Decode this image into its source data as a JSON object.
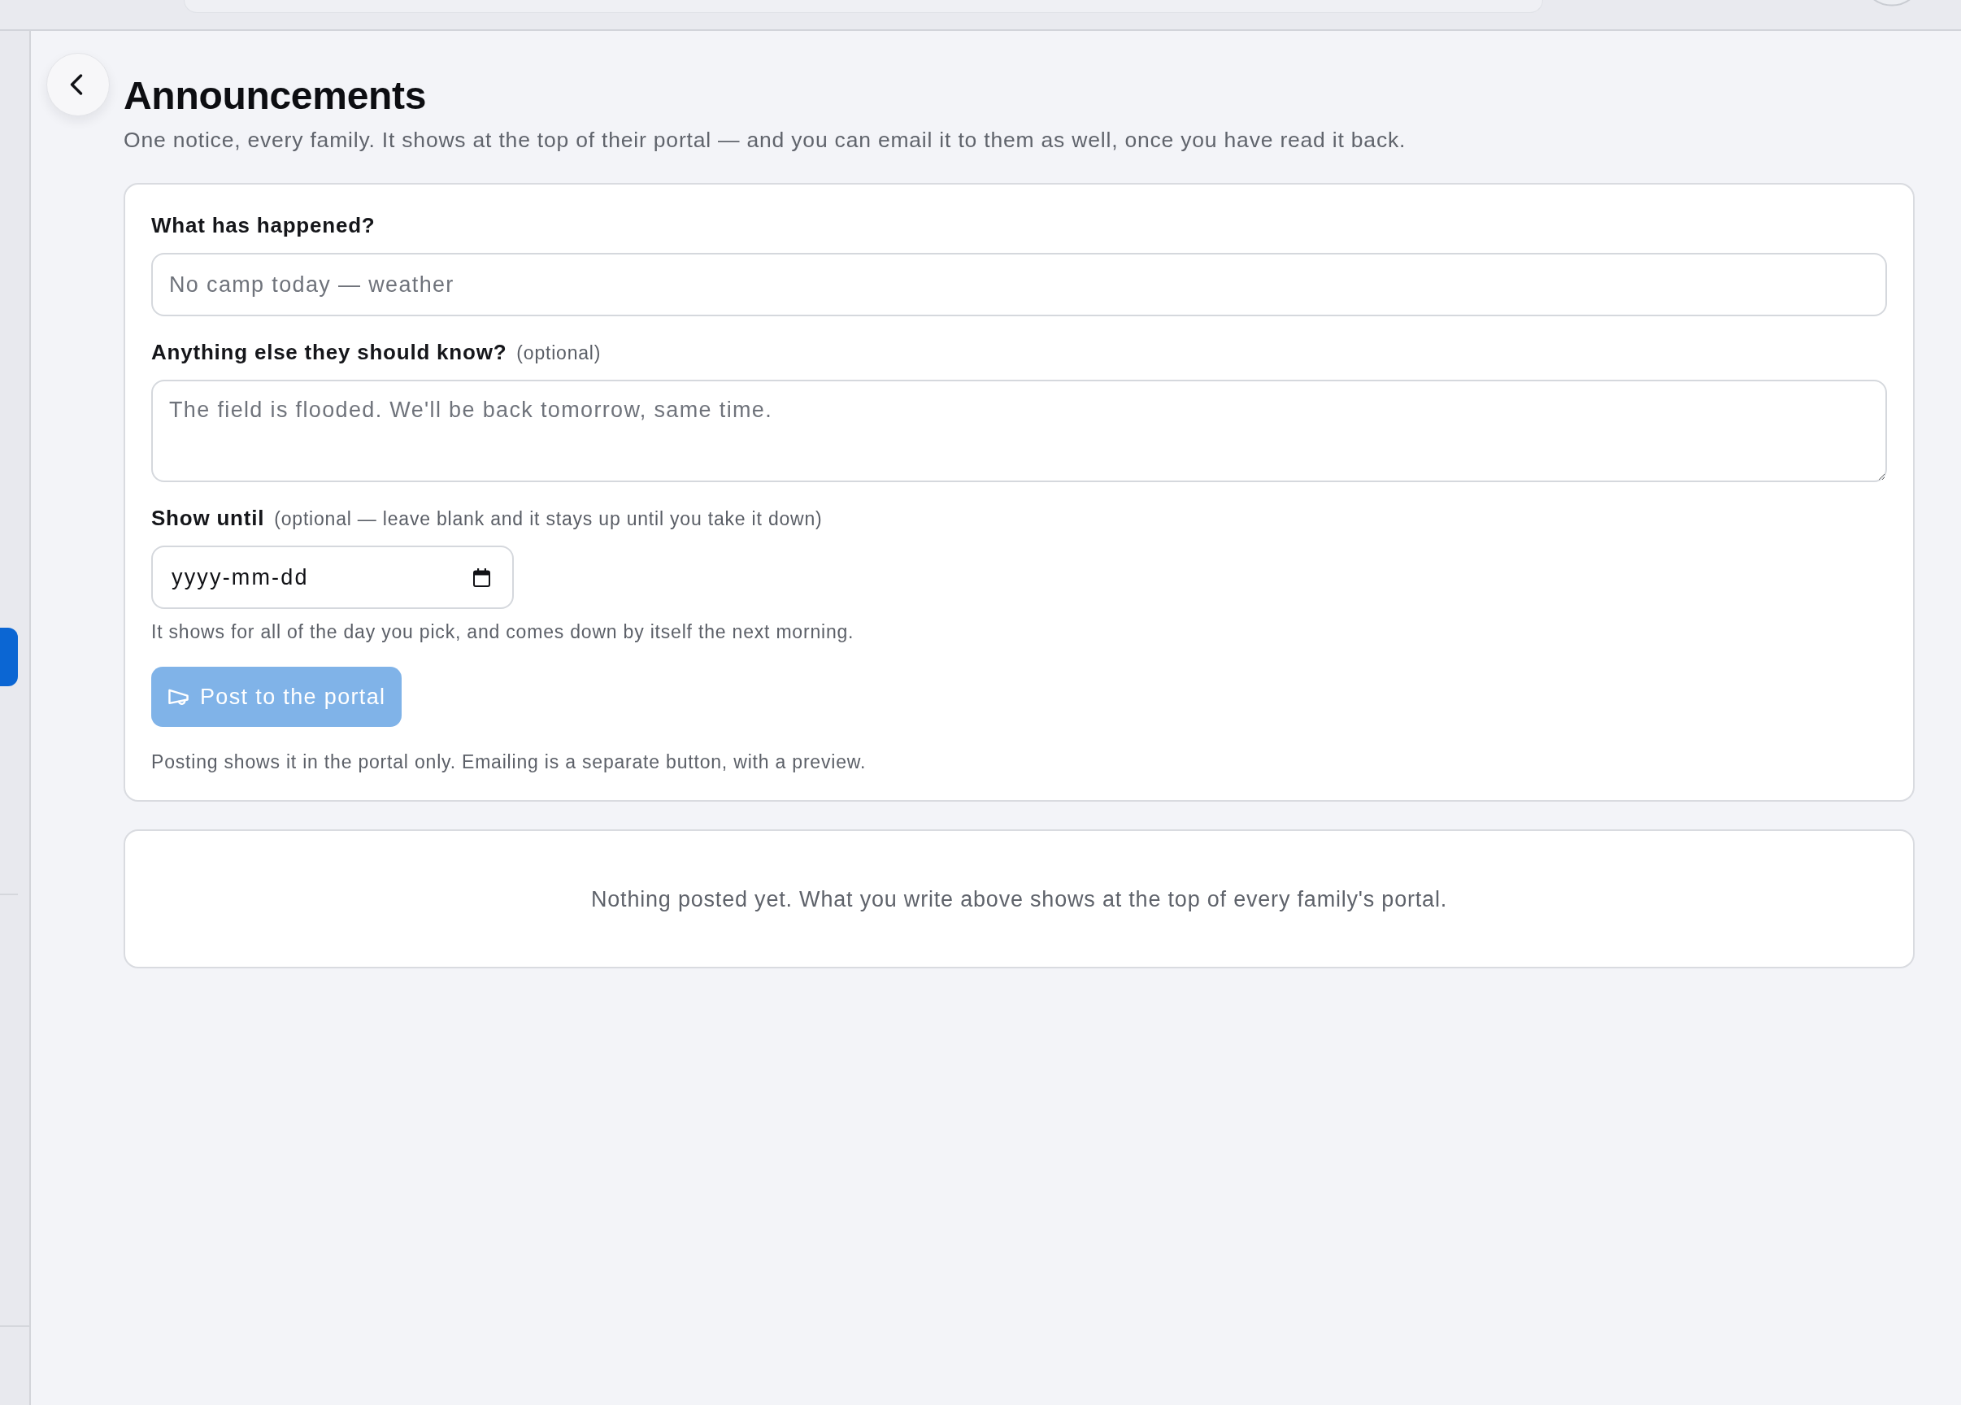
{
  "page": {
    "title": "Announcements",
    "subtitle": "One notice, every family. It shows at the top of their portal — and you can email it to them as well, once you have read it back."
  },
  "compose_form": {
    "fields": [
      {
        "kind": "text",
        "label": "What has happened?",
        "placeholder": "No camp today — weather"
      },
      {
        "kind": "textarea",
        "label": "Anything else they should know?",
        "note": "(optional)",
        "placeholder": "The field is flooded. We'll be back tomorrow, same time."
      },
      {
        "kind": "date",
        "label": "Show until",
        "note": "(optional — leave blank and it stays up until you take it down)",
        "placeholder": "yyyy-mm-dd",
        "hint": "It shows for all of the day you pick, and comes down by itself the next morning."
      }
    ],
    "post_button": {
      "label": "Post to the portal",
      "disabled": true
    },
    "note": "Posting shows it in the portal only. Emailing is a separate button, with a preview."
  },
  "posted": {
    "empty_message": "Nothing posted yet. What you write above shows at the top of every family's portal."
  }
}
